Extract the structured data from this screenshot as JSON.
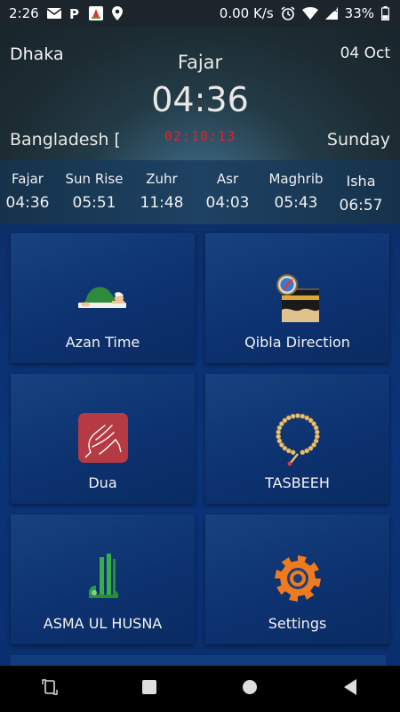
{
  "status_bar": {
    "time": "2:26",
    "net_speed": "0.00 K/s",
    "battery": "33%",
    "icons": [
      "mail-icon",
      "parking-icon",
      "notification-app-icon",
      "location-icon",
      "alarm-icon",
      "wifi-icon",
      "signal-icon",
      "battery-icon"
    ]
  },
  "header": {
    "city": "Dhaka",
    "date": "04 Oct",
    "prayer_name": "Fajar",
    "prayer_time": "04:36",
    "country": "Bangladesh [",
    "countdown": "02:10:13",
    "day": "Sunday",
    "countdown_color": "#e1222a"
  },
  "prayers": [
    {
      "name": "Fajar",
      "time": "04:36"
    },
    {
      "name": "Sun Rise",
      "time": "05:51"
    },
    {
      "name": "Zuhr",
      "time": "11:48"
    },
    {
      "name": "Asr",
      "time": "04:03"
    },
    {
      "name": "Maghrib",
      "time": "05:43"
    },
    {
      "name": "Isha",
      "time": "06:57"
    }
  ],
  "tiles": [
    {
      "label": "Azan Time",
      "icon": "praying-person-icon"
    },
    {
      "label": "Qibla Direction",
      "icon": "kaaba-compass-icon"
    },
    {
      "label": "Dua",
      "icon": "praying-hands-icon"
    },
    {
      "label": "TASBEEH",
      "icon": "prayer-beads-icon"
    },
    {
      "label": "ASMA UL HUSNA",
      "icon": "allah-calligraphy-icon"
    },
    {
      "label": "Settings",
      "icon": "gear-icon"
    }
  ],
  "nav_bar": [
    "rotate-icon",
    "recent-apps-icon",
    "home-icon",
    "back-icon"
  ]
}
